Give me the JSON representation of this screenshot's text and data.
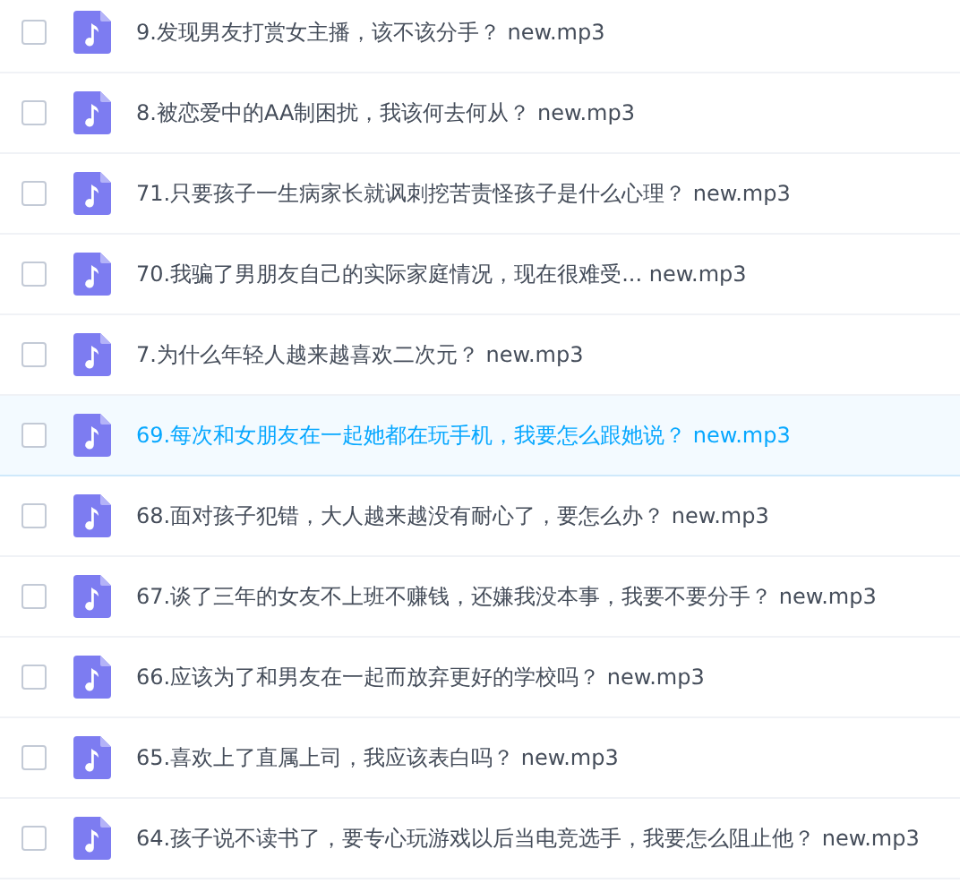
{
  "files": [
    {
      "name": "9.发现男友打赏女主播，该不该分手？ new.mp3",
      "checked": false,
      "selected": false
    },
    {
      "name": "8.被恋爱中的AA制困扰，我该何去何从？ new.mp3",
      "checked": false,
      "selected": false
    },
    {
      "name": "71.只要孩子一生病家长就讽刺挖苦责怪孩子是什么心理？ new.mp3",
      "checked": false,
      "selected": false
    },
    {
      "name": "70.我骗了男朋友自己的实际家庭情况，现在很难受... new.mp3",
      "checked": false,
      "selected": false
    },
    {
      "name": "7.为什么年轻人越来越喜欢二次元？ new.mp3",
      "checked": false,
      "selected": false
    },
    {
      "name": "69.每次和女朋友在一起她都在玩手机，我要怎么跟她说？ new.mp3",
      "checked": false,
      "selected": true
    },
    {
      "name": "68.面对孩子犯错，大人越来越没有耐心了，要怎么办？ new.mp3",
      "checked": false,
      "selected": false
    },
    {
      "name": "67.谈了三年的女友不上班不赚钱，还嫌我没本事，我要不要分手？ new.mp3",
      "checked": false,
      "selected": false
    },
    {
      "name": "66.应该为了和男友在一起而放弃更好的学校吗？ new.mp3",
      "checked": false,
      "selected": false
    },
    {
      "name": "65.喜欢上了直属上司，我应该表白吗？ new.mp3",
      "checked": false,
      "selected": false
    },
    {
      "name": "64.孩子说不读书了，要专心玩游戏以后当电竞选手，我要怎么阻止他？ new.mp3",
      "checked": false,
      "selected": false
    }
  ]
}
